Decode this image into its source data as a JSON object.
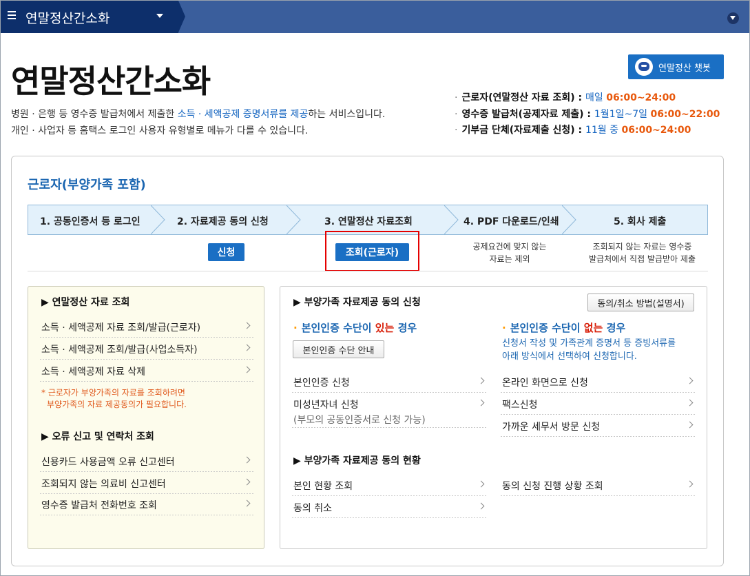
{
  "topbar": {
    "title": "연말정산간소화"
  },
  "header": {
    "title": "연말정산간소화",
    "desc_line1_pre": "병원 · 은행 등 영수증 발급처에서 제출한 ",
    "desc_line1_hl": "소득 · 세액공제 증명서류를 제공",
    "desc_line1_post": "하는 서비스입니다.",
    "desc_line2": "개인 · 사업자 등 홈택스 로그인 사용자 유형별로 메뉴가 다를 수 있습니다.",
    "chatbot_label": "연말정산 챗봇"
  },
  "schedule": [
    {
      "label": "근로자(연말정산 자료 조회) : ",
      "when": "매일 ",
      "time": "06:00~24:00"
    },
    {
      "label": "영수증 발급처(공제자료 제출) : ",
      "when": "1월1일~7일 ",
      "time": "06:00~22:00"
    },
    {
      "label": "기부금 단체(자료제출 신청) : ",
      "when": "11월 중 ",
      "time": "06:00~24:00"
    }
  ],
  "section": {
    "title": "근로자(부양가족 포함)"
  },
  "steps": [
    {
      "label": "1. 공동인증서 등 로그인"
    },
    {
      "label": "2. 자료제공 동의 신청"
    },
    {
      "label": "3. 연말정산 자료조회"
    },
    {
      "label": "4. PDF 다운로드/인쇄"
    },
    {
      "label": "5. 회사 제출"
    }
  ],
  "step_actions": {
    "apply_label": "신청",
    "query_label": "조회(근로자)",
    "note4_line1": "공제요건에 맞지 않는",
    "note4_line2": "자료는 제외",
    "note5_line1": "조회되지 않는 자료는 영수증",
    "note5_line2": "발급처에서 직접 발급받아 제출"
  },
  "left": {
    "heading1": "▶ 연말정산 자료 조회",
    "items1": [
      "소득 · 세액공제 자료 조회/발급(근로자)",
      "소득 · 세액공제 조회/발급(사업소득자)",
      "소득 · 세액공제 자료 삭제"
    ],
    "note_line1": "* 근로자가 부양가족의 자료를 조회하려면",
    "note_line2": "부양가족의 자료 제공동의가 필요합니다.",
    "heading2": "▶ 오류 신고 및 연락처 조회",
    "items2": [
      "신용카드 사용금액 오류 신고센터",
      "조회되지 않는 의료비 신고센터",
      "영수증 발급처 전화번호 조회"
    ]
  },
  "right": {
    "heading1": "▶ 부양가족 자료제공 동의 신청",
    "manual_btn": "동의/취소 방법(설명서)",
    "has_auth_pre": "본인인증 수단이 ",
    "has_auth_red": "있는",
    "has_auth_post": " 경우",
    "no_auth_pre": "본인인증 수단이 ",
    "no_auth_red": "없는",
    "no_auth_post": " 경우",
    "auth_guide_btn": "본인인증 수단 안내",
    "no_auth_note1": "신청서 작성 및 가족관계 증명서 등 증빙서류를",
    "no_auth_note2": "아래 방식에서 선택하여 신청합니다.",
    "left_items": [
      "본인인증 신청",
      "미성년자녀 신청"
    ],
    "minor_sub": "(부모의 공동인증서로 신청 가능)",
    "right_items": [
      "온라인 화면으로 신청",
      "팩스신청",
      "가까운 세무서 방문 신청"
    ],
    "heading2": "▶ 부양가족 자료제공 동의 현황",
    "status_left": [
      "본인 현황 조회",
      "동의 취소"
    ],
    "status_right": [
      "동의 신청 진행 상황 조회"
    ]
  }
}
